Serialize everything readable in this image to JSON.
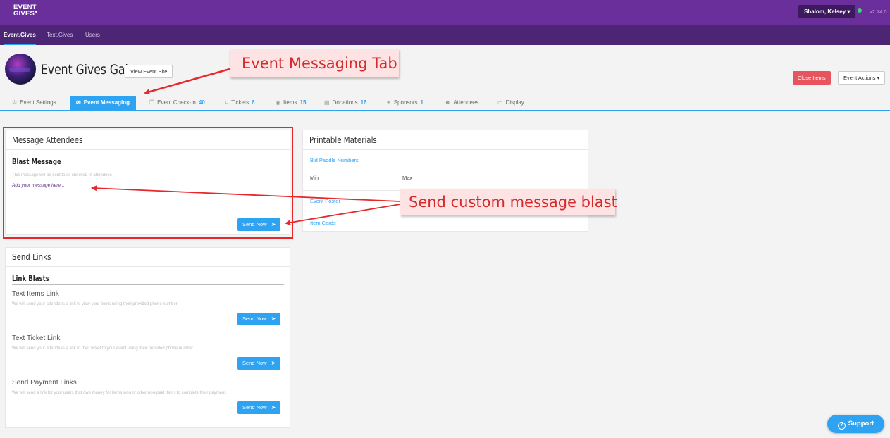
{
  "topbar": {
    "logo_line1": "EVENT",
    "logo_line2": "GIVES",
    "user_label": "Shalom, Kelsey ▾",
    "version": "v2.74.0"
  },
  "appnav": {
    "items": [
      {
        "label": "Event.Gives",
        "active": true
      },
      {
        "label": "Text.Gives",
        "active": false
      },
      {
        "label": "Users",
        "active": false
      }
    ]
  },
  "event": {
    "title": "Event Gives Gala",
    "view_site_label": "View Event Site",
    "close_items_label": "Close Items",
    "event_actions_label": "Event Actions ▾"
  },
  "tabs": [
    {
      "icon": "gear-icon",
      "glyph": "⚙",
      "label": "Event Settings",
      "count": ""
    },
    {
      "icon": "envelope-icon",
      "glyph": "✉",
      "label": "Event Messaging",
      "count": "",
      "active": true
    },
    {
      "icon": "copy-icon",
      "glyph": "❐",
      "label": "Event Check-In",
      "count": "40"
    },
    {
      "icon": "tag-icon",
      "glyph": "⌑",
      "label": "Tickets",
      "count": "6"
    },
    {
      "icon": "eye-icon",
      "glyph": "◉",
      "label": "Items",
      "count": "15"
    },
    {
      "icon": "document-icon",
      "glyph": "▤",
      "label": "Donations",
      "count": "16"
    },
    {
      "icon": "handshake-icon",
      "glyph": "⚭",
      "label": "Sponsors",
      "count": "1"
    },
    {
      "icon": "users-icon",
      "glyph": "☻",
      "label": "Attendees",
      "count": ""
    },
    {
      "icon": "monitor-icon",
      "glyph": "▭",
      "label": "Display",
      "count": ""
    }
  ],
  "message_attendees": {
    "title": "Message Attendees",
    "section": "Blast Message",
    "hint": "This message will be sent to all checked-in attendees",
    "placeholder": "Add your message here...",
    "send_label": "Send Now"
  },
  "send_links": {
    "title": "Send Links",
    "section": "Link Blasts",
    "items": [
      {
        "title": "Text Items Link",
        "hint": "We will send your attendees a link to view your items using their provided phone number.",
        "send_label": "Send Now"
      },
      {
        "title": "Text Ticket Link",
        "hint": "We will send your attendees a link to their ticket to your event using their provided phone number.",
        "send_label": "Send Now"
      },
      {
        "title": "Send Payment Links",
        "hint": "We will send a link for your users that owe money for items won or other non-paid items to complete their payment.",
        "send_label": "Send Now"
      }
    ]
  },
  "printable": {
    "title": "Printable Materials",
    "bid_paddle": "Bid Paddle Numbers",
    "min_label": "Min",
    "max_label": "Max",
    "event_poster": "Event Poster",
    "item_cards": "Item Cards"
  },
  "annotations": {
    "tab_callout": "Event Messaging Tab",
    "blast_callout": "Send custom message blast"
  },
  "support": {
    "label": "Support"
  },
  "colors": {
    "topbar": "#6a2f9a",
    "appnav": "#4c2674",
    "accent": "#2ea3f2",
    "danger": "#e8545d",
    "annotation": "#e8272b"
  }
}
